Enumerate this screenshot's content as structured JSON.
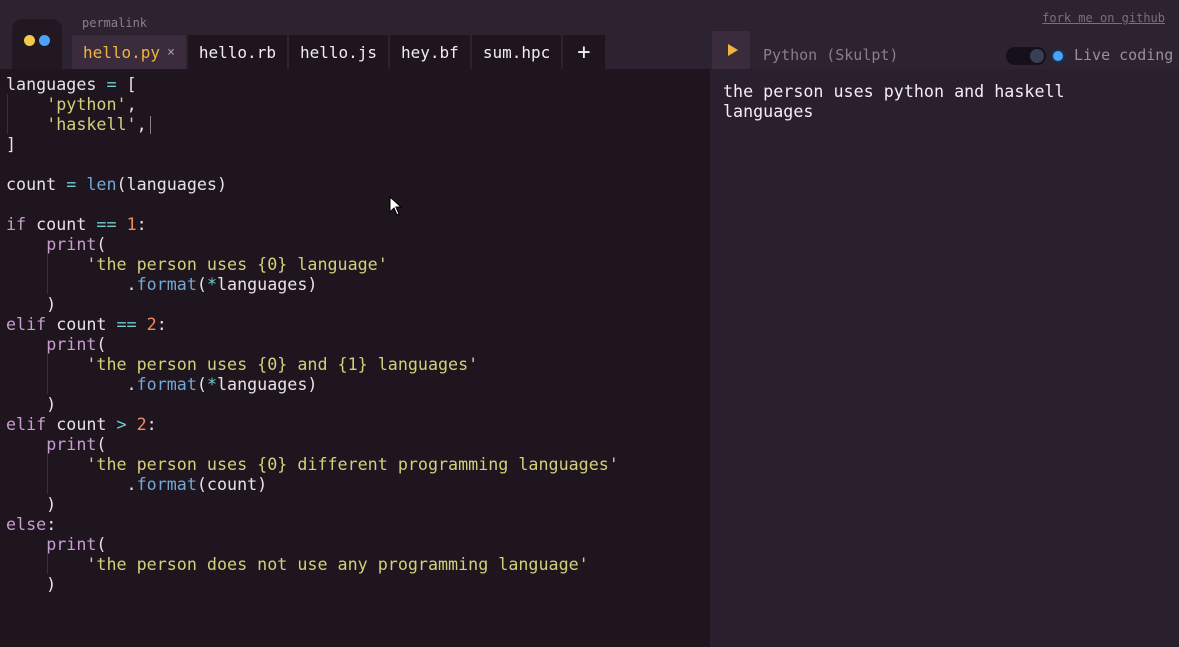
{
  "header": {
    "permalink": "permalink",
    "fork": "fork me on github"
  },
  "tabs": [
    {
      "label": "hello.py",
      "close": "×",
      "active": true
    },
    {
      "label": "hello.rb"
    },
    {
      "label": "hello.js"
    },
    {
      "label": "hey.bf"
    },
    {
      "label": "sum.hpc"
    },
    {
      "label": "+"
    }
  ],
  "toolbar": {
    "runtime": "Python (Skulpt)",
    "live_coding": "Live coding",
    "live_coding_on": true
  },
  "code": [
    [
      [
        "t",
        "languages "
      ],
      [
        "op",
        "="
      ],
      [
        "t",
        " ["
      ]
    ],
    [
      [
        "t",
        "    "
      ],
      [
        "str",
        "'python'"
      ],
      [
        "t",
        ","
      ]
    ],
    [
      [
        "t",
        "    "
      ],
      [
        "str",
        "'haskell'"
      ],
      [
        "t",
        ","
      ]
    ],
    [
      [
        "t",
        "]"
      ]
    ],
    [],
    [
      [
        "t",
        "count "
      ],
      [
        "op",
        "="
      ],
      [
        "t",
        " "
      ],
      [
        "fn",
        "len"
      ],
      [
        "t",
        "(languages)"
      ]
    ],
    [],
    [
      [
        "kw",
        "if"
      ],
      [
        "t",
        " count "
      ],
      [
        "op",
        "=="
      ],
      [
        "t",
        " "
      ],
      [
        "num",
        "1"
      ],
      [
        "t",
        ":"
      ]
    ],
    [
      [
        "t",
        "    "
      ],
      [
        "kw",
        "print"
      ],
      [
        "t",
        "("
      ]
    ],
    [
      [
        "t",
        "        "
      ],
      [
        "str",
        "'the person uses {0} language'"
      ]
    ],
    [
      [
        "t",
        "            ."
      ],
      [
        "fn",
        "format"
      ],
      [
        "t",
        "("
      ],
      [
        "op",
        "*"
      ],
      [
        "t",
        "languages)"
      ]
    ],
    [
      [
        "t",
        "    )"
      ]
    ],
    [
      [
        "kw",
        "elif"
      ],
      [
        "t",
        " count "
      ],
      [
        "op",
        "=="
      ],
      [
        "t",
        " "
      ],
      [
        "num",
        "2"
      ],
      [
        "t",
        ":"
      ]
    ],
    [
      [
        "t",
        "    "
      ],
      [
        "kw",
        "print"
      ],
      [
        "t",
        "("
      ]
    ],
    [
      [
        "t",
        "        "
      ],
      [
        "str",
        "'the person uses {0} and {1} languages'"
      ]
    ],
    [
      [
        "t",
        "            ."
      ],
      [
        "fn",
        "format"
      ],
      [
        "t",
        "("
      ],
      [
        "op",
        "*"
      ],
      [
        "t",
        "languages)"
      ]
    ],
    [
      [
        "t",
        "    )"
      ]
    ],
    [
      [
        "kw",
        "elif"
      ],
      [
        "t",
        " count "
      ],
      [
        "op",
        ">"
      ],
      [
        "t",
        " "
      ],
      [
        "num",
        "2"
      ],
      [
        "t",
        ":"
      ]
    ],
    [
      [
        "t",
        "    "
      ],
      [
        "kw",
        "print"
      ],
      [
        "t",
        "("
      ]
    ],
    [
      [
        "t",
        "        "
      ],
      [
        "str",
        "'the person uses {0} different programming languages'"
      ]
    ],
    [
      [
        "t",
        "            ."
      ],
      [
        "fn",
        "format"
      ],
      [
        "t",
        "(count)"
      ]
    ],
    [
      [
        "t",
        "    )"
      ]
    ],
    [
      [
        "kw",
        "else"
      ],
      [
        "t",
        ":"
      ]
    ],
    [
      [
        "t",
        "    "
      ],
      [
        "kw",
        "print"
      ],
      [
        "t",
        "("
      ]
    ],
    [
      [
        "t",
        "        "
      ],
      [
        "str",
        "'the person does not use any programming language'"
      ]
    ],
    [
      [
        "t",
        "    )"
      ]
    ]
  ],
  "output": {
    "text": "the person uses python and haskell languages"
  }
}
